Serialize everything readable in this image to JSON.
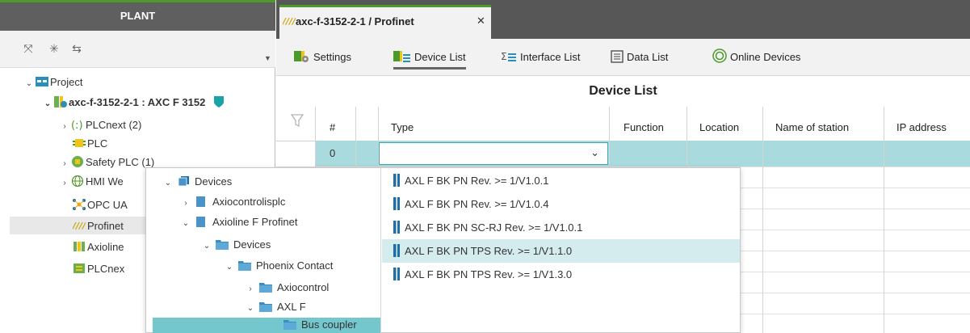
{
  "plant": {
    "title": "PLANT",
    "tree": {
      "project": "Project",
      "controller": "axc-f-3152-2-1 : AXC F 3152",
      "plcnext": "PLCnext (2)",
      "plc": "PLC",
      "safety_plc": "Safety PLC (1)",
      "hmi_web": "HMI We",
      "opc_ua": "OPC UA",
      "profinet": "Profinet",
      "axioline": "Axioline",
      "plcnext_short": "PLCnex"
    }
  },
  "editor": {
    "tab_label": "axc-f-3152-2-1 / Profinet",
    "toolbar": {
      "settings": "Settings",
      "device_list": "Device List",
      "interface_list": "Interface List",
      "data_list": "Data List",
      "online_devices": "Online Devices"
    },
    "grid_title": "Device List",
    "columns": [
      "#",
      "Type",
      "Function",
      "Location",
      "Name of station",
      "IP address"
    ],
    "rows": [
      {
        "num": "0",
        "type": ""
      }
    ]
  },
  "popup": {
    "tree": {
      "devices": "Devices",
      "axiocontrolisplc": "Axiocontrolisplc",
      "axioline_profinet": "Axioline F Profinet",
      "devices_sub": "Devices",
      "phoenix_contact": "Phoenix Contact",
      "axiocontrol": "Axiocontrol",
      "axl_f": "AXL F",
      "bus_coupler": "Bus coupler"
    },
    "devices": [
      "AXL F BK PN Rev. >= 1/V1.0.1",
      "AXL F BK PN Rev. >= 1/V1.0.4",
      "AXL F BK PN SC-RJ Rev. >= 1/V1.0.1",
      "AXL F BK PN TPS Rev. >= 1/V1.1.0",
      "AXL F BK PN TPS Rev. >= 1/V1.3.0"
    ],
    "selected_device": "AXL F BK PN TPS Rev. >= 1/V1.1.0"
  },
  "colors": {
    "accent_green": "#4c9a2a",
    "selection_teal": "#a9dadd",
    "tree_selection": "#74c7cc",
    "icon_blue": "#1e6fa8"
  }
}
